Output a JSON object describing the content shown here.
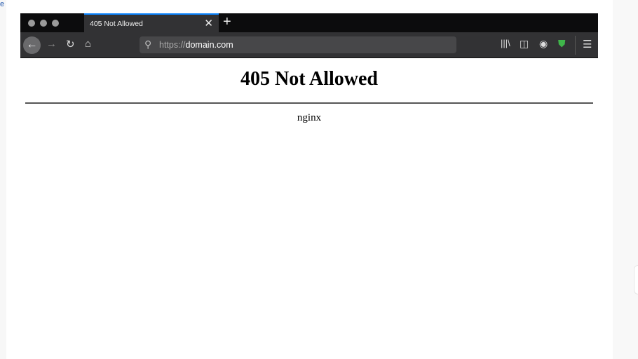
{
  "edge_text": "e",
  "browser": {
    "tab_title": "405 Not Allowed",
    "url_scheme": "https://",
    "url_host": "domain.com",
    "accent": "#0a84ff"
  },
  "page": {
    "heading": "405 Not Allowed",
    "footer": "nginx"
  }
}
